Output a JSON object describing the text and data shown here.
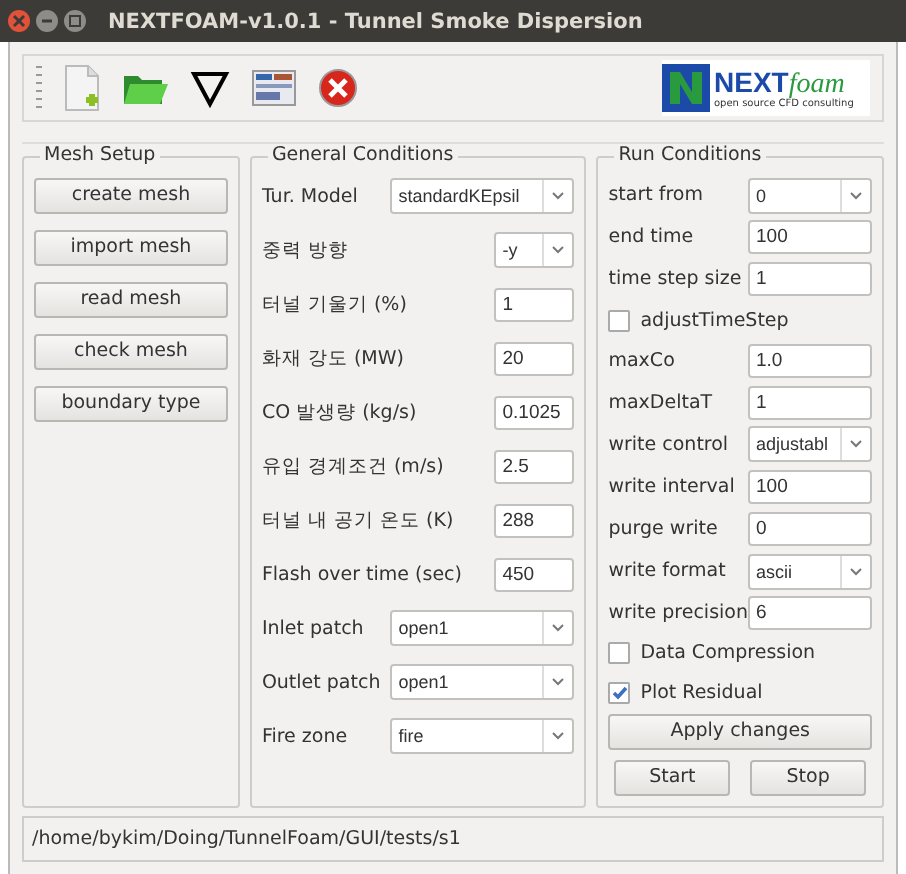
{
  "window": {
    "title": "NEXTFOAM-v1.0.1 - Tunnel Smoke Dispersion"
  },
  "logo": {
    "brand": "NEXT",
    "brand_italic": "foam",
    "tagline": "open source CFD consulting"
  },
  "mesh_setup": {
    "title": "Mesh Setup",
    "buttons": [
      "create mesh",
      "import mesh",
      "read mesh",
      "check mesh",
      "boundary type"
    ]
  },
  "general_conditions": {
    "title": "General Conditions",
    "fields": [
      {
        "kind": "combo",
        "label": "Tur. Model",
        "value": "standardKEpsil"
      },
      {
        "kind": "combo",
        "label": "중력 방향",
        "value": "-y",
        "short": true
      },
      {
        "kind": "text",
        "label": "터널 기울기 (%)",
        "value": "1"
      },
      {
        "kind": "text",
        "label": "화재 강도 (MW)",
        "value": "20"
      },
      {
        "kind": "text",
        "label": "CO 발생량 (kg/s)",
        "value": "0.1025"
      },
      {
        "kind": "text",
        "label": "유입 경계조건 (m/s)",
        "value": "2.5"
      },
      {
        "kind": "text",
        "label": "터널 내 공기 온도 (K)",
        "value": "288"
      },
      {
        "kind": "text",
        "label": "Flash over time (sec)",
        "value": "450"
      },
      {
        "kind": "combo",
        "label": "Inlet patch",
        "value": "open1"
      },
      {
        "kind": "combo",
        "label": "Outlet patch",
        "value": "open1"
      },
      {
        "kind": "combo",
        "label": "Fire zone",
        "value": "fire"
      }
    ]
  },
  "run_conditions": {
    "title": "Run Conditions",
    "fields": [
      {
        "kind": "combo",
        "label": "start from",
        "value": "0"
      },
      {
        "kind": "text",
        "label": "end time",
        "value": "100"
      },
      {
        "kind": "text",
        "label": "time step size",
        "value": "1"
      },
      {
        "kind": "check",
        "label": "adjustTimeStep",
        "checked": false
      },
      {
        "kind": "text",
        "label": "maxCo",
        "value": "1.0"
      },
      {
        "kind": "text",
        "label": "maxDeltaT",
        "value": "1"
      },
      {
        "kind": "combo",
        "label": "write control",
        "value": "adjustabl"
      },
      {
        "kind": "text",
        "label": "write interval",
        "value": "100"
      },
      {
        "kind": "text",
        "label": "purge write",
        "value": "0"
      },
      {
        "kind": "combo",
        "label": "write format",
        "value": "ascii"
      },
      {
        "kind": "text",
        "label": "write precision",
        "value": "6"
      },
      {
        "kind": "check",
        "label": "Data Compression",
        "checked": false
      },
      {
        "kind": "check",
        "label": "Plot Residual",
        "checked": true
      }
    ],
    "apply_button": "Apply changes",
    "start_button": "Start",
    "stop_button": "Stop"
  },
  "status_bar": {
    "path": "/home/bykim/Doing/TunnelFoam/GUI/tests/s1"
  }
}
